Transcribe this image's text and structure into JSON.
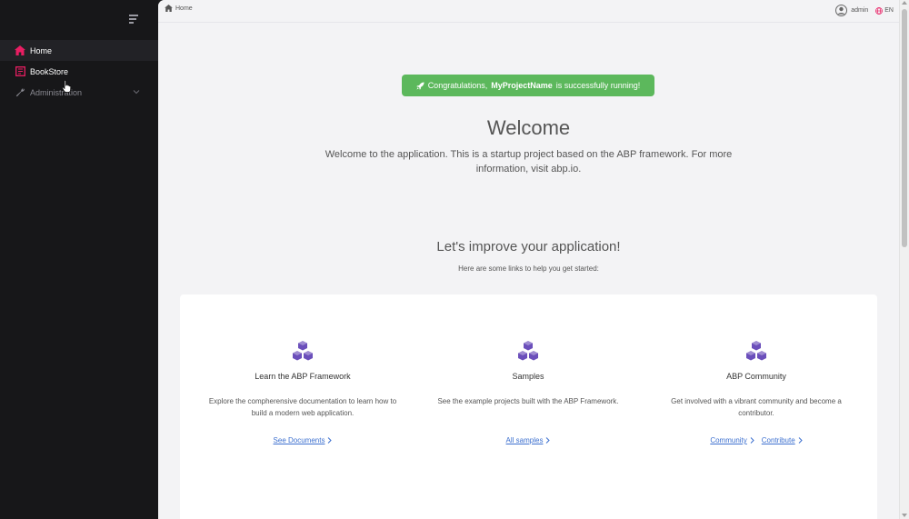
{
  "sidebar": {
    "items": [
      {
        "label": "Home",
        "icon": "home-icon",
        "active": true
      },
      {
        "label": "BookStore",
        "icon": "book-icon",
        "active": false
      },
      {
        "label": "Administration",
        "icon": "wrench-icon",
        "active": false
      }
    ]
  },
  "topbar": {
    "breadcrumb": "Home",
    "user": "admin",
    "language": "EN"
  },
  "alert": {
    "prefix": "Congratulations,",
    "project": "MyProjectName",
    "suffix": "is successfully running!"
  },
  "welcome": {
    "title": "Welcome",
    "text": "Welcome to the application. This is a startup project based on the ABP framework. For more information, visit abp.io."
  },
  "improve": {
    "title": "Let's improve your application!",
    "subtitle": "Here are some links to help you get started:"
  },
  "cards": [
    {
      "title": "Learn the ABP Framework",
      "description": "Explore the compherensive documentation to learn how to build a modern web application.",
      "links": [
        "See Documents"
      ]
    },
    {
      "title": "Samples",
      "description": "See the example projects built with the ABP Framework.",
      "links": [
        "All samples"
      ]
    },
    {
      "title": "ABP Community",
      "description": "Get involved with a vibrant community and become a contributor.",
      "links": [
        "Community",
        "Contribute"
      ]
    }
  ],
  "colors": {
    "accent_pink": "#e91e63",
    "success_green": "#5cb85c",
    "link_blue": "#3b6fcf",
    "icon_purple": "#6b4fbb"
  }
}
